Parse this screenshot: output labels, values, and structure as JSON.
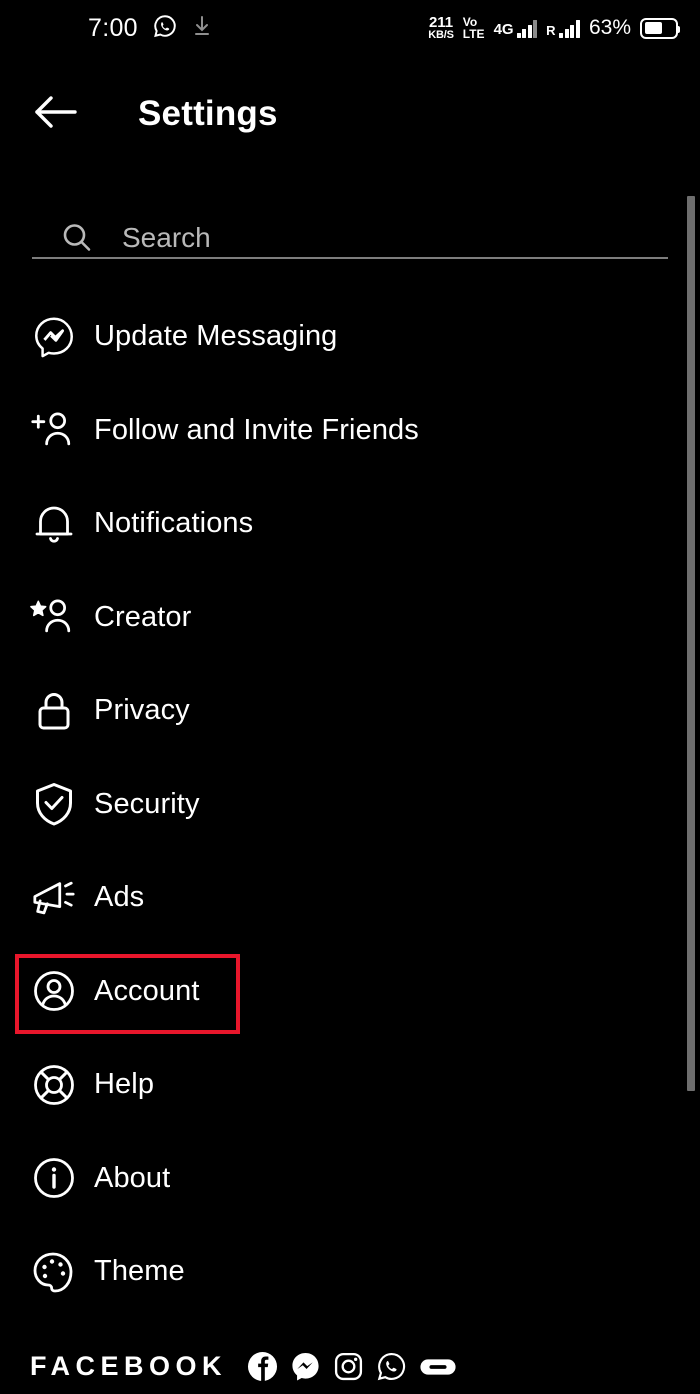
{
  "status_bar": {
    "clock": "7:00",
    "whatsapp_icon": "whatsapp-icon",
    "download_icon": "download-icon",
    "net_speed_value": "211",
    "net_speed_unit": "KB/S",
    "volte_top": "Vo",
    "volte_bottom": "LTE",
    "network_type": "4G",
    "roaming_label": "R",
    "battery_percent": "63%"
  },
  "header": {
    "back_icon": "back-arrow-icon",
    "title": "Settings"
  },
  "search": {
    "icon": "search-icon",
    "placeholder": "Search"
  },
  "menu": {
    "items": [
      {
        "label": "Update Messaging",
        "icon": "messenger-icon",
        "highlighted": false
      },
      {
        "label": "Follow and Invite Friends",
        "icon": "add-person-icon",
        "highlighted": false
      },
      {
        "label": "Notifications",
        "icon": "bell-icon",
        "highlighted": false
      },
      {
        "label": "Creator",
        "icon": "star-person-icon",
        "highlighted": false
      },
      {
        "label": "Privacy",
        "icon": "lock-icon",
        "highlighted": false
      },
      {
        "label": "Security",
        "icon": "shield-check-icon",
        "highlighted": false
      },
      {
        "label": "Ads",
        "icon": "megaphone-icon",
        "highlighted": false
      },
      {
        "label": "Account",
        "icon": "account-circle-icon",
        "highlighted": true
      },
      {
        "label": "Help",
        "icon": "lifebuoy-icon",
        "highlighted": false
      },
      {
        "label": "About",
        "icon": "info-circle-icon",
        "highlighted": false
      },
      {
        "label": "Theme",
        "icon": "palette-icon",
        "highlighted": false
      }
    ]
  },
  "footer": {
    "brand": "FACEBOOK",
    "icons": [
      "facebook-icon",
      "messenger-icon",
      "instagram-icon",
      "whatsapp-icon",
      "oculus-icon"
    ]
  },
  "colors": {
    "background": "#000000",
    "text": "#ffffff",
    "muted_text": "#b9b9b9",
    "highlight_border": "#e8162b",
    "scrollbar": "#6e6e6e",
    "divider": "#7d7d7d"
  }
}
